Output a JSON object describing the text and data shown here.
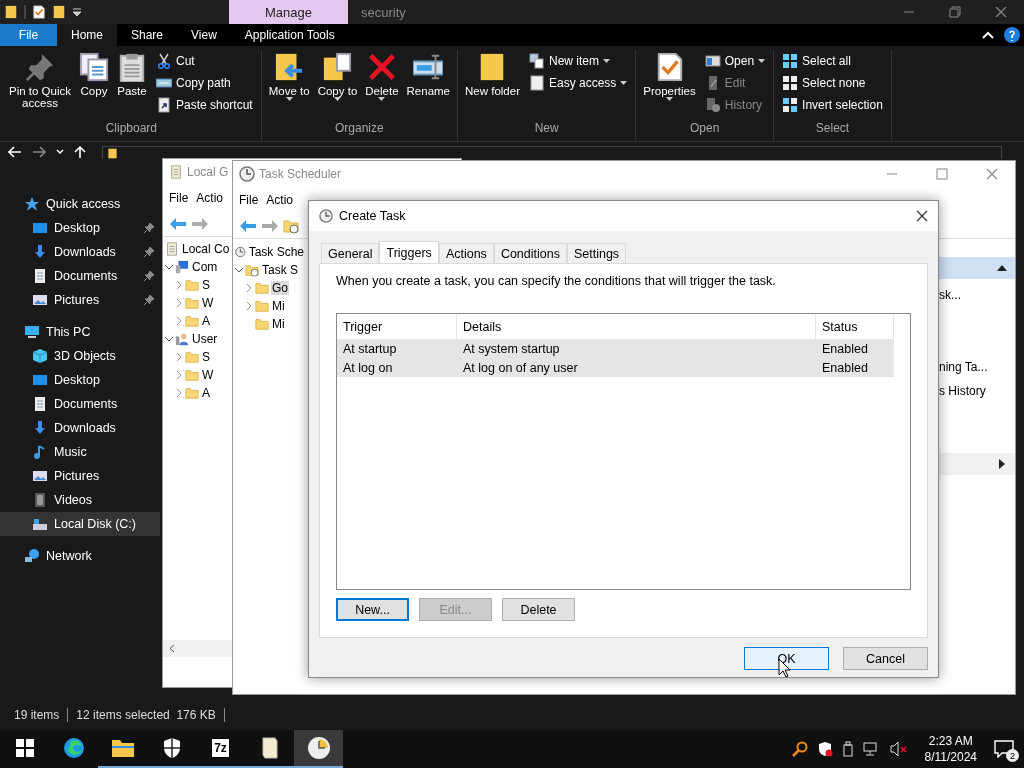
{
  "explorer": {
    "context_tab": "Manage",
    "title": "security",
    "ribbon_tabs": [
      {
        "label": "File",
        "kind": "file",
        "selected": false
      },
      {
        "label": "Home",
        "kind": "tab",
        "selected": true
      },
      {
        "label": "Share",
        "kind": "tab",
        "selected": false
      },
      {
        "label": "View",
        "kind": "tab",
        "selected": false
      },
      {
        "label": "Application Tools",
        "kind": "tab",
        "selected": false
      }
    ],
    "ribbon_groups": [
      {
        "label": "Clipboard",
        "items": [
          {
            "kind": "large",
            "label": "Pin to Quick access"
          },
          {
            "kind": "large",
            "label": "Copy"
          },
          {
            "kind": "large",
            "label": "Paste"
          },
          {
            "kind": "stack",
            "items": [
              {
                "label": "Cut"
              },
              {
                "label": "Copy path"
              },
              {
                "label": "Paste shortcut"
              }
            ]
          }
        ]
      },
      {
        "label": "Organize",
        "items": [
          {
            "kind": "large",
            "label": "Move to",
            "caret": true
          },
          {
            "kind": "large",
            "label": "Copy to",
            "caret": true
          },
          {
            "kind": "large",
            "label": "Delete",
            "caret": true
          },
          {
            "kind": "large",
            "label": "Rename"
          }
        ]
      },
      {
        "label": "New",
        "items": [
          {
            "kind": "large",
            "label": "New folder"
          },
          {
            "kind": "stack",
            "items": [
              {
                "label": "New item",
                "caret": true
              },
              {
                "label": "Easy access",
                "caret": true
              }
            ]
          }
        ]
      },
      {
        "label": "Open",
        "items": [
          {
            "kind": "large",
            "label": "Properties",
            "caret": true
          },
          {
            "kind": "stack",
            "items": [
              {
                "label": "Open",
                "caret": true
              },
              {
                "label": "Edit",
                "disabled": true
              },
              {
                "label": "History",
                "disabled": true
              }
            ]
          }
        ]
      },
      {
        "label": "Select",
        "items": [
          {
            "kind": "stack",
            "items": [
              {
                "label": "Select all"
              },
              {
                "label": "Select none"
              },
              {
                "label": "Invert selection"
              }
            ]
          }
        ]
      }
    ],
    "nav": [
      {
        "label": "Quick access",
        "selected": false,
        "children": [
          {
            "label": "Desktop",
            "pinned": true,
            "selected": false
          },
          {
            "label": "Downloads",
            "pinned": true,
            "selected": false
          },
          {
            "label": "Documents",
            "pinned": true,
            "selected": false
          },
          {
            "label": "Pictures",
            "pinned": true,
            "selected": false
          }
        ]
      },
      {
        "label": "This PC",
        "selected": false,
        "children": [
          {
            "label": "3D Objects",
            "selected": false
          },
          {
            "label": "Desktop",
            "selected": false
          },
          {
            "label": "Documents",
            "selected": false
          },
          {
            "label": "Downloads",
            "selected": false
          },
          {
            "label": "Music",
            "selected": false
          },
          {
            "label": "Pictures",
            "selected": false
          },
          {
            "label": "Videos",
            "selected": false
          },
          {
            "label": "Local Disk (C:)",
            "selected": true
          }
        ]
      },
      {
        "label": "Network",
        "selected": false
      }
    ],
    "status": [
      "19 items",
      "12 items selected  176 KB"
    ]
  },
  "policy_window": {
    "title": "Local G",
    "menu": [
      "File",
      "Actio"
    ],
    "tree": [
      {
        "label": "Local Co",
        "kind": "policy",
        "children": [
          {
            "label": "Com",
            "kind": "computer",
            "expanded": true,
            "children": [
              {
                "label": "S",
                "kind": "folder",
                "expanded": false
              },
              {
                "label": "W",
                "kind": "folder",
                "expanded": false
              },
              {
                "label": "A",
                "kind": "folder",
                "expanded": false
              }
            ]
          },
          {
            "label": "User",
            "kind": "user",
            "expanded": true,
            "children": [
              {
                "label": "S",
                "kind": "folder",
                "expanded": false
              },
              {
                "label": "W",
                "kind": "folder",
                "expanded": false
              },
              {
                "label": "A",
                "kind": "folder",
                "expanded": false
              }
            ]
          }
        ]
      }
    ]
  },
  "scheduler": {
    "title": "Task Scheduler",
    "menu": [
      "File",
      "Actio"
    ],
    "tree": [
      {
        "label": "Task Sche",
        "kind": "clock",
        "children": [
          {
            "label": "Task S",
            "kind": "library",
            "expanded": true,
            "children": [
              {
                "label": "Go",
                "kind": "folder",
                "expanded": false,
                "selected": true
              },
              {
                "label": "Mi",
                "kind": "folder",
                "expanded": false,
                "selected": false
              },
              {
                "label": "Mi",
                "kind": "folder",
                "selected": false
              }
            ]
          }
        ]
      }
    ],
    "actions": [
      "sk...",
      "ning Ta...",
      "s History"
    ]
  },
  "dialog": {
    "title": "Create Task",
    "tabs": [
      {
        "label": "General",
        "selected": false
      },
      {
        "label": "Triggers",
        "selected": true
      },
      {
        "label": "Actions",
        "selected": false
      },
      {
        "label": "Conditions",
        "selected": false
      },
      {
        "label": "Settings",
        "selected": false
      }
    ],
    "intro": "When you create a task, you can specify the conditions that will trigger the task.",
    "columns": [
      "Trigger",
      "Details",
      "Status"
    ],
    "rows": [
      {
        "cells": [
          "At startup",
          "At system startup",
          "Enabled"
        ],
        "selected": true
      },
      {
        "cells": [
          "At log on",
          "At log on of any user",
          "Enabled"
        ],
        "selected": true
      }
    ],
    "buttons": [
      {
        "label": "New...",
        "default": true,
        "disabled": false
      },
      {
        "label": "Edit...",
        "default": false,
        "disabled": true
      },
      {
        "label": "Delete",
        "default": false,
        "disabled": false
      }
    ],
    "footer": [
      {
        "label": "OK",
        "highlighted": true
      },
      {
        "label": "Cancel",
        "highlighted": false
      }
    ]
  },
  "taskbar": {
    "apps": [
      {
        "running": false,
        "active": false
      },
      {
        "running": true,
        "active": false
      },
      {
        "running": true,
        "active": false
      },
      {
        "label": "7z",
        "running": true,
        "active": false
      },
      {
        "running": true,
        "active": false
      },
      {
        "running": true,
        "active": true
      }
    ],
    "time": "2:23 AM",
    "date": "8/11/2024",
    "notifications": "2"
  }
}
